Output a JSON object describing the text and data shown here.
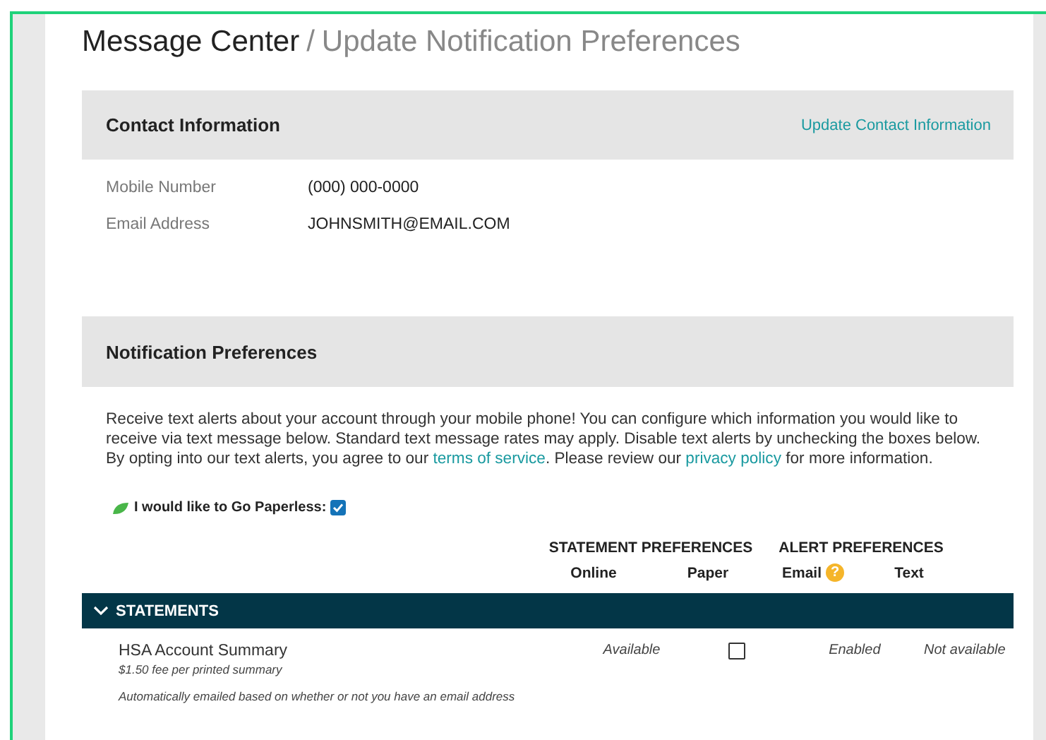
{
  "breadcrumb": {
    "current": "Message Center",
    "separator": "/",
    "page": "Update Notification Preferences"
  },
  "contact": {
    "title": "Contact Information",
    "link": "Update Contact Information",
    "fields": [
      {
        "label": "Mobile Number",
        "value": "(000) 000-0000"
      },
      {
        "label": "Email Address",
        "value": "JOHNSMITH@EMAIL.COM"
      }
    ]
  },
  "notifications": {
    "title": "Notification Preferences",
    "intro": [
      "Receive text alerts about your account through your mobile phone! You can configure which information you would like to receive via text message below. Standard text message rates may apply. Disable text alerts by unchecking the boxes below. By opting into our text alerts, you agree to our ",
      "terms of service",
      ". Please review our ",
      "privacy policy",
      " for more information."
    ],
    "paperless": {
      "label": "I would like to Go Paperless:",
      "checked": true
    },
    "groups": [
      {
        "title": "STATEMENT PREFERENCES",
        "columns": [
          "Online",
          "Paper"
        ]
      },
      {
        "title": "ALERT PREFERENCES",
        "columns": [
          "Email",
          "Text"
        ],
        "help_mark": "?"
      }
    ],
    "section": {
      "title": "STATEMENTS",
      "expanded": true,
      "rows": [
        {
          "name": "HSA Account Summary",
          "note": "$1.50 fee per printed summary",
          "online": "Available",
          "paper_checked": false,
          "email": "Enabled",
          "text": "Not available",
          "footnote": "Automatically emailed based on whether or not you have an email address"
        }
      ]
    }
  }
}
